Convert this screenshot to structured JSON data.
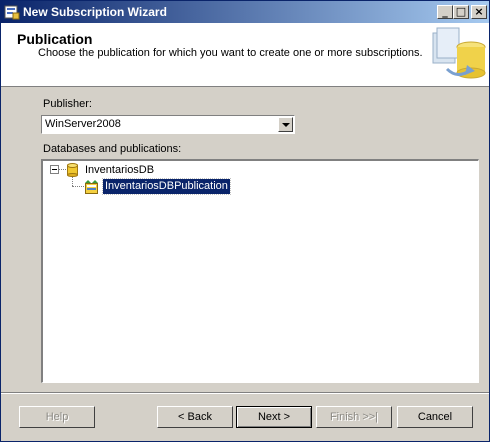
{
  "window": {
    "title": "New Subscription Wizard",
    "minimize_glyph": "_",
    "maximize_glyph": "□",
    "close_glyph": "×"
  },
  "header": {
    "title": "Publication",
    "subtitle": "Choose the publication for which you want to create one or more subscriptions."
  },
  "publisher": {
    "label": "Publisher:",
    "selected": "WinServer2008"
  },
  "tree": {
    "label": "Databases and publications:",
    "database": {
      "name": "InventariosDB",
      "icon": "database-icon",
      "expanded": true
    },
    "publication": {
      "name": "InventariosDBPublication",
      "icon": "publication-icon",
      "selected": true
    }
  },
  "buttons": {
    "help": "Help",
    "back": "< Back",
    "next": "Next >",
    "finish": "Finish >>|",
    "cancel": "Cancel"
  },
  "colors": {
    "titlebar": "#0a246a",
    "selection": "#0a246a",
    "face": "#d4d0c8"
  }
}
